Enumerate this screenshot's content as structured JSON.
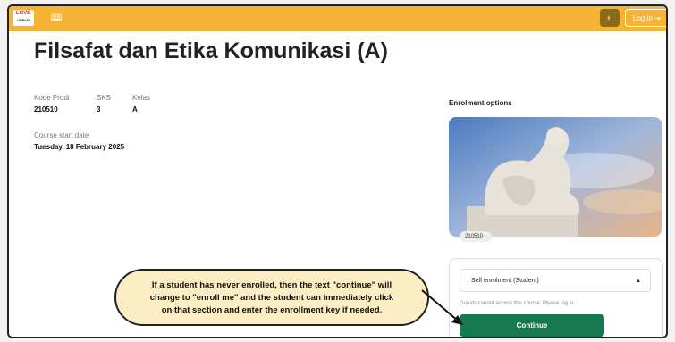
{
  "topbar": {
    "logo_main": "LOVE",
    "logo_sub": "UNPAR",
    "book_icon": "book-icon",
    "theme_icon": "half-moon-icon",
    "login_label": "Log in",
    "login_icon": "login-icon",
    "bg": "#f6b335"
  },
  "course": {
    "title": "Filsafat dan Etika Komunikasi (A)",
    "kode_label": "Kode Prodi",
    "kode_value": "210510",
    "sks_label": "SKS",
    "sks_value": "3",
    "kelas_label": "Kelas",
    "kelas_value": "A",
    "start_label": "Course start date",
    "start_value": "Tuesday, 18 February 2025"
  },
  "enrolment": {
    "heading": "Enrolment options",
    "course_tag": "210510 -",
    "method": "Self enrolment (Student)",
    "guest_note": "Guests cannot access this course. Please log in.",
    "continue_label": "Continue",
    "button_color": "#16784f"
  },
  "callout": {
    "line1": "If a student has never enrolled, then the text \"continue\" will",
    "line2": "change to \"enroll me\" and the student can immediately click",
    "line3": "on that section and enter the enrollment key if needed."
  }
}
